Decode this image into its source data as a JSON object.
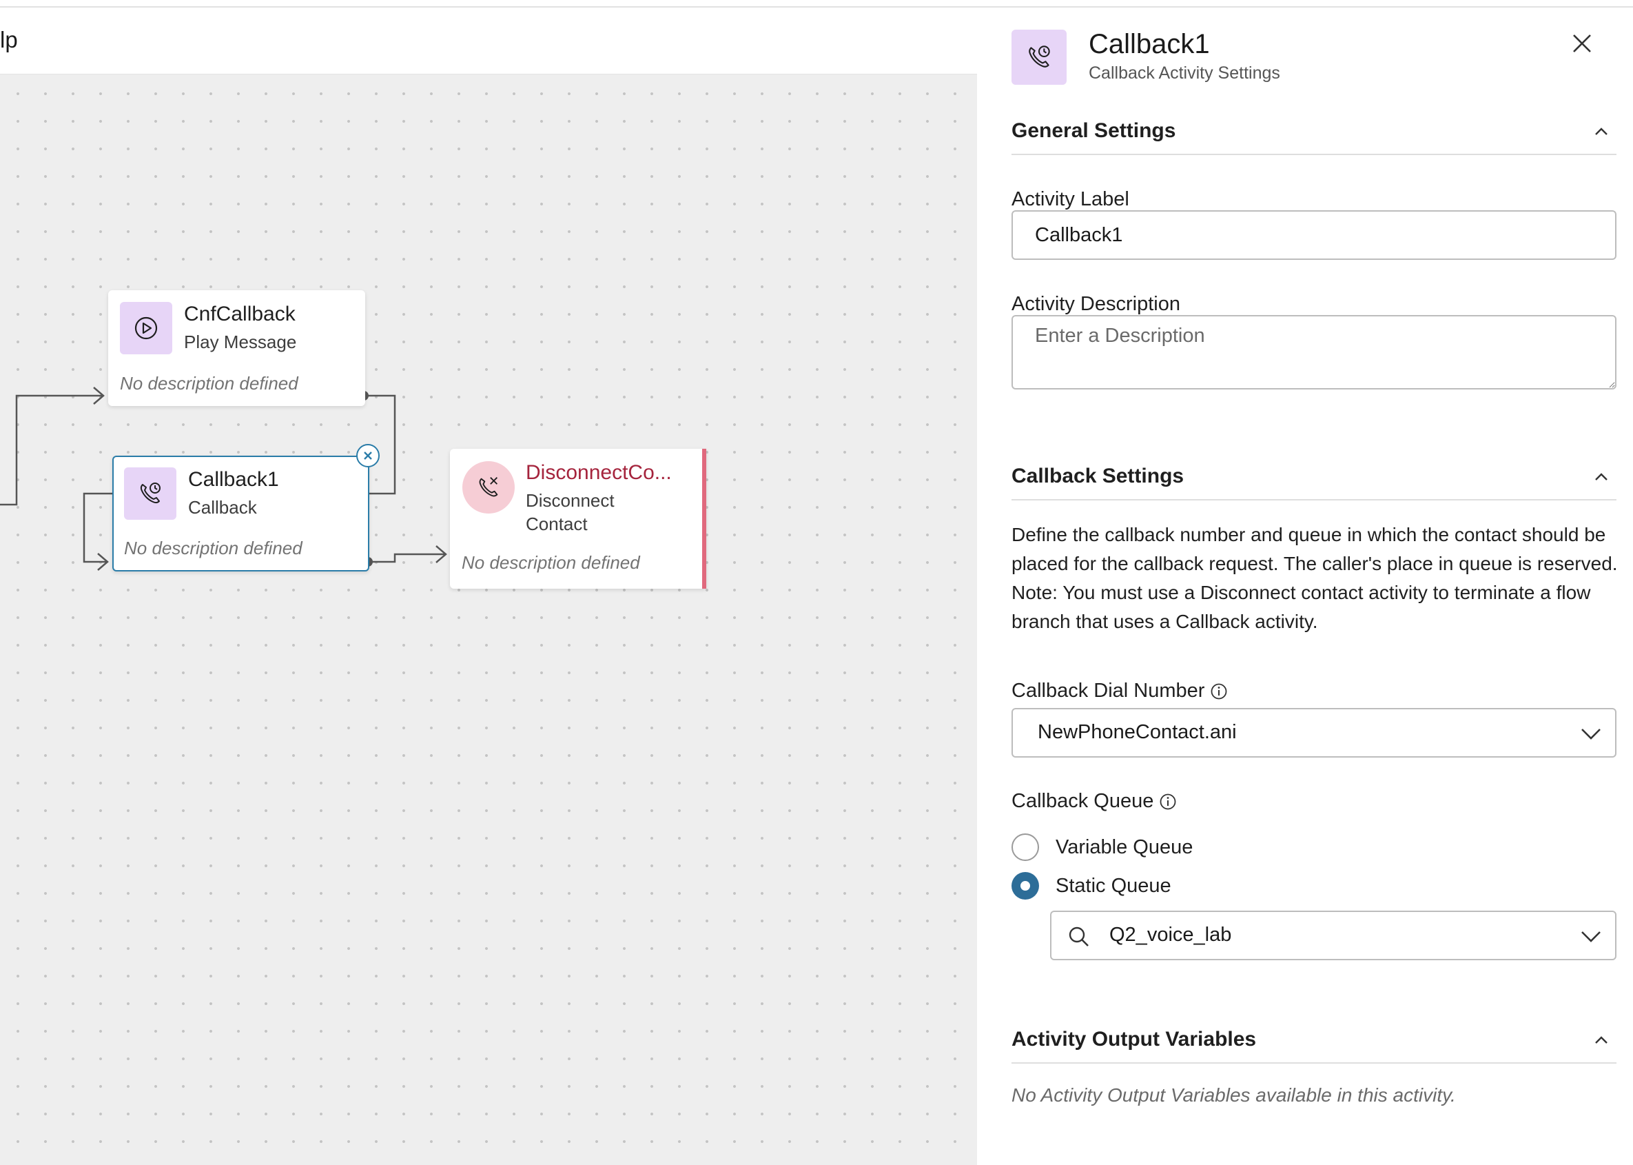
{
  "toolbar": {
    "partial_text": "lp"
  },
  "canvas": {
    "nodes": {
      "cnf": {
        "title": "CnfCallback",
        "subtitle": "Play Message",
        "description": "No description defined",
        "icon": "play-message-icon"
      },
      "callback": {
        "title": "Callback1",
        "subtitle": "Callback",
        "description": "No description defined",
        "icon": "callback-phone-icon"
      },
      "disconnect": {
        "title": "DisconnectCo...",
        "subtitle_line1": "Disconnect",
        "subtitle_line2": "Contact",
        "description": "No description defined",
        "icon": "disconnect-phone-icon",
        "title_color": "#a5243d",
        "error_bar_color": "#e0697d"
      }
    }
  },
  "panel": {
    "title": "Callback1",
    "subtitle": "Callback Activity Settings",
    "general": {
      "heading": "General Settings",
      "activity_label": "Activity Label",
      "activity_label_value": "Callback1",
      "activity_description": "Activity Description",
      "description_placeholder": "Enter a Description"
    },
    "callback": {
      "heading": "Callback Settings",
      "description": "Define the callback number and queue in which the contact should be placed for the callback request. The caller's place in queue is reserved. Note: You must use a Disconnect contact activity to terminate a flow branch that uses a Callback activity.",
      "dial_number_label": "Callback Dial Number",
      "dial_number_value": "NewPhoneContact.ani",
      "queue_label": "Callback Queue",
      "queue_options": [
        "Variable Queue",
        "Static Queue"
      ],
      "queue_selected": "Static Queue",
      "static_queue_value": "Q2_voice_lab"
    },
    "output": {
      "heading": "Activity Output Variables",
      "empty": "No Activity Output Variables available in this activity."
    }
  },
  "colors": {
    "accent": "#2d6d98",
    "selected_border": "#2a7ca8",
    "icon_bg": "#e7d5f7",
    "error": "#e0697d"
  }
}
